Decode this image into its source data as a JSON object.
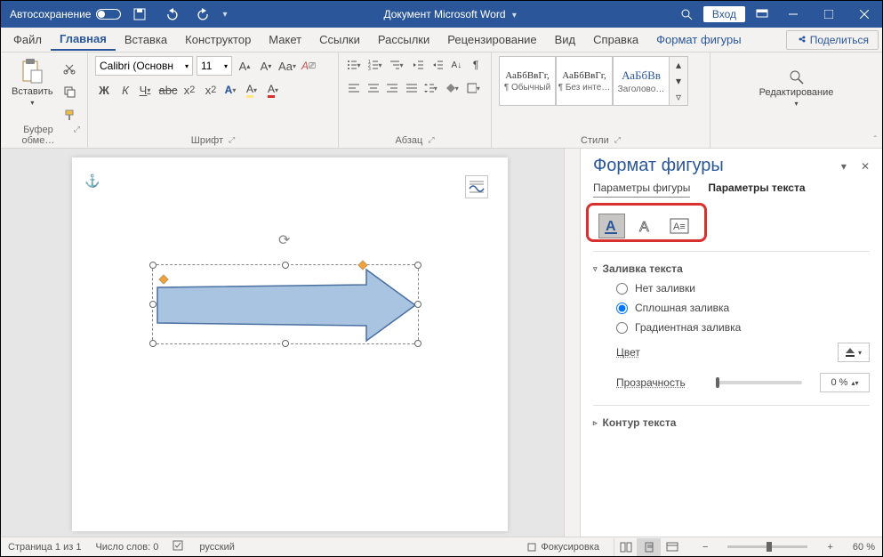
{
  "titlebar": {
    "autosave": "Автосохранение",
    "doc_title": "Документ Microsoft Word",
    "login": "Вход"
  },
  "tabs": {
    "file": "Файл",
    "home": "Главная",
    "insert": "Вставка",
    "design": "Конструктор",
    "layout": "Макет",
    "references": "Ссылки",
    "mailings": "Рассылки",
    "review": "Рецензирование",
    "view": "Вид",
    "help": "Справка",
    "shape_format": "Формат фигуры",
    "share": "Поделиться"
  },
  "ribbon": {
    "clipboard": {
      "paste": "Вставить",
      "label": "Буфер обме…"
    },
    "font": {
      "label": "Шрифт",
      "name": "Calibri (Основн",
      "size": "11"
    },
    "paragraph": {
      "label": "Абзац"
    },
    "styles": {
      "label": "Стили",
      "items": [
        {
          "sample": "АаБбВвГг,",
          "name": "¶ Обычный"
        },
        {
          "sample": "АаБбВвГг,",
          "name": "¶ Без инте…"
        },
        {
          "sample": "АаБбВв",
          "name": "Заголово…"
        }
      ]
    },
    "editing": {
      "label": "Редактирование"
    }
  },
  "pane": {
    "title": "Формат фигуры",
    "tab_shape": "Параметры фигуры",
    "tab_text": "Параметры текста",
    "section_fill": "Заливка текста",
    "fill_none": "Нет заливки",
    "fill_solid": "Сплошная заливка",
    "fill_gradient": "Градиентная заливка",
    "color": "Цвет",
    "transparency": "Прозрачность",
    "transparency_value": "0 %",
    "section_outline": "Контур текста"
  },
  "status": {
    "page": "Страница 1 из 1",
    "words": "Число слов: 0",
    "lang": "русский",
    "focus": "Фокусировка",
    "zoom": "60 %"
  }
}
